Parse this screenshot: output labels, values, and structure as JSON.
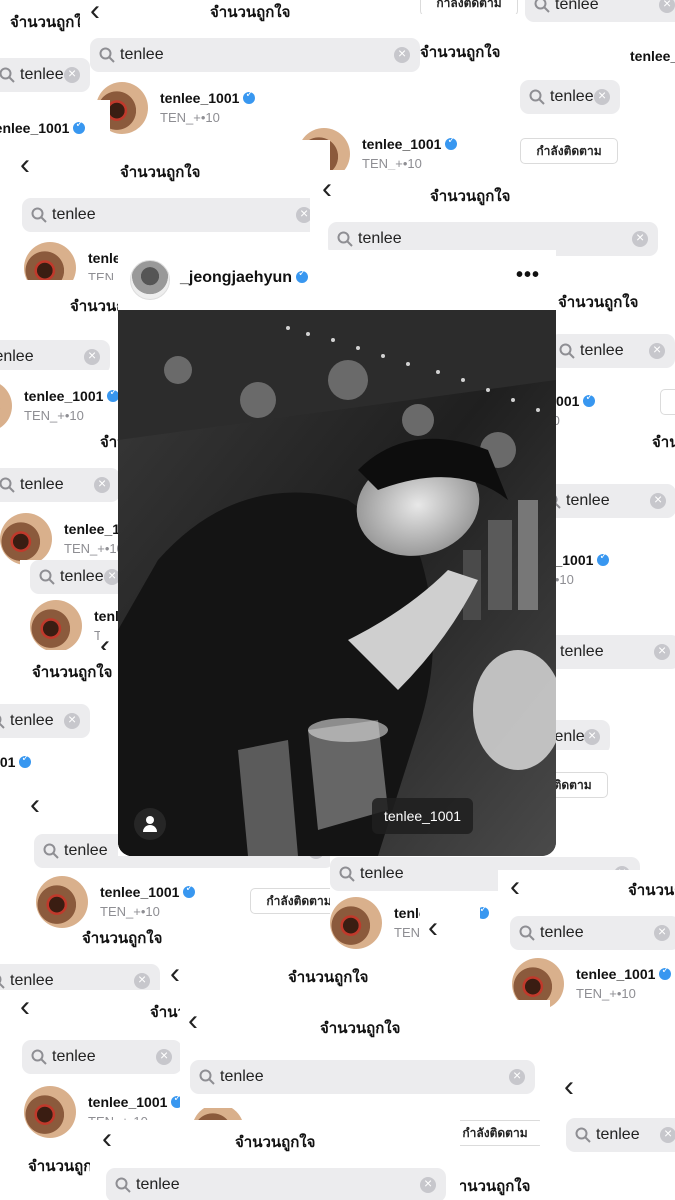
{
  "screen": {
    "title": "จำนวนถูกใจ",
    "search_query": "tenlee",
    "result": {
      "username": "tenlee_1001",
      "fullname": "TEN_+•10",
      "follow_label": "กำลังติดตาม",
      "verified": true
    }
  },
  "post": {
    "username": "_jeongjaehyun",
    "verified": true,
    "more_label": "•••",
    "photo_alt": "",
    "tag_label": "tenlee_1001"
  },
  "colors": {
    "verified": "#3897f0",
    "search_bg": "#ececee",
    "tag_bg": "#1e1e1e"
  },
  "icons": [
    "back-chevron-icon",
    "search-icon",
    "clear-icon",
    "verified-badge-icon",
    "more-icon",
    "person-tag-icon"
  ]
}
